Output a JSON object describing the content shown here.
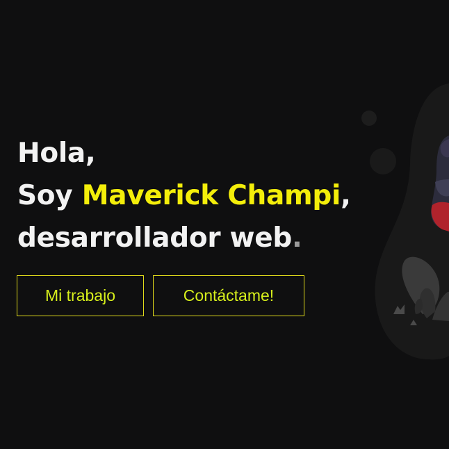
{
  "hero": {
    "greeting": "Hola,",
    "intro_prefix": "Soy ",
    "name": "Maverick Champi",
    "intro_suffix": ",",
    "role": "desarrollador web",
    "role_dot": "."
  },
  "buttons": {
    "work_label": "Mi trabajo",
    "contact_label": "Contáctame!"
  },
  "colors": {
    "background": "#0f0f10",
    "accent": "#f4ee0a",
    "text": "#f2f2f2"
  }
}
